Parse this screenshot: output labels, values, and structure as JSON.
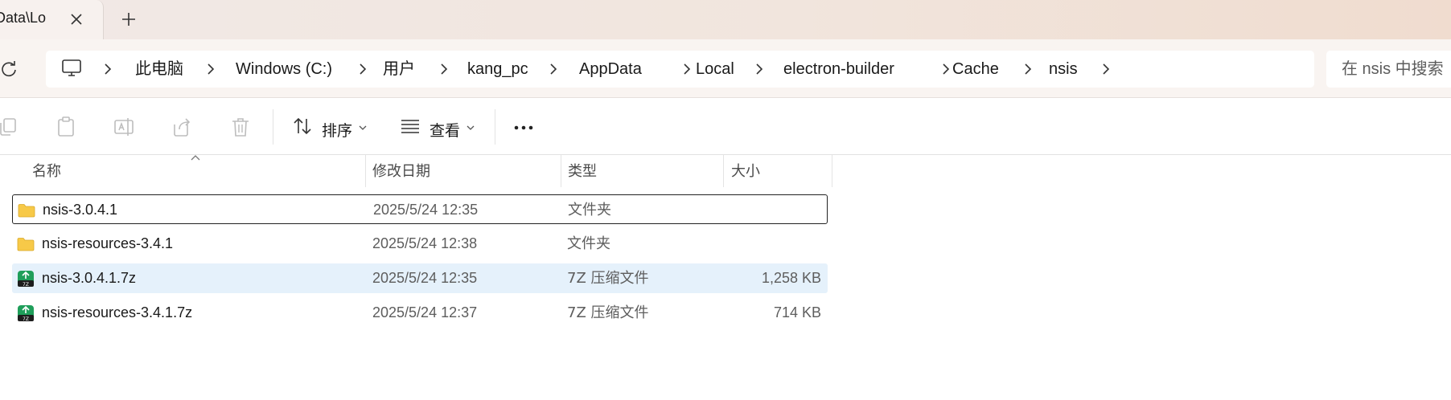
{
  "tab": {
    "title": "Data\\Lo",
    "close_icon": "close-icon",
    "new_tab_icon": "plus-icon"
  },
  "address": {
    "refresh_icon": "refresh-icon",
    "computer_icon": "computer-icon",
    "crumbs": [
      "此电脑",
      "Windows (C:)",
      "用户",
      "kang_pc",
      "AppData",
      "Local",
      "electron-builder",
      "Cache",
      "nsis"
    ],
    "search_placeholder": "在 nsis 中搜索"
  },
  "toolbar": {
    "sort_label": "排序",
    "view_label": "查看",
    "more_icon": "more-icon",
    "icons": [
      "copy-icon",
      "paste-icon",
      "rename-icon",
      "share-icon",
      "delete-icon"
    ]
  },
  "columns": {
    "name": "名称",
    "date": "修改日期",
    "type": "类型",
    "size": "大小"
  },
  "files": [
    {
      "name": "nsis-3.0.4.1",
      "date": "2025/5/24 12:35",
      "type": "文件夹",
      "size": "",
      "icon": "folder-icon"
    },
    {
      "name": "nsis-resources-3.4.1",
      "date": "2025/5/24 12:38",
      "type": "文件夹",
      "size": "",
      "icon": "folder-icon"
    },
    {
      "name": "nsis-3.0.4.1.7z",
      "date": "2025/5/24 12:35",
      "type": "7Z 压缩文件",
      "size": "1,258 KB",
      "icon": "7z-archive-icon"
    },
    {
      "name": "nsis-resources-3.4.1.7z",
      "date": "2025/5/24 12:37",
      "type": "7Z 压缩文件",
      "size": "714 KB",
      "icon": "7z-archive-icon"
    }
  ],
  "colors": {
    "accent": "#0067c0",
    "selection_bg": "#e5f1fb",
    "folder_yellow": "#f7c948",
    "archive_green": "#1f9e5a"
  }
}
